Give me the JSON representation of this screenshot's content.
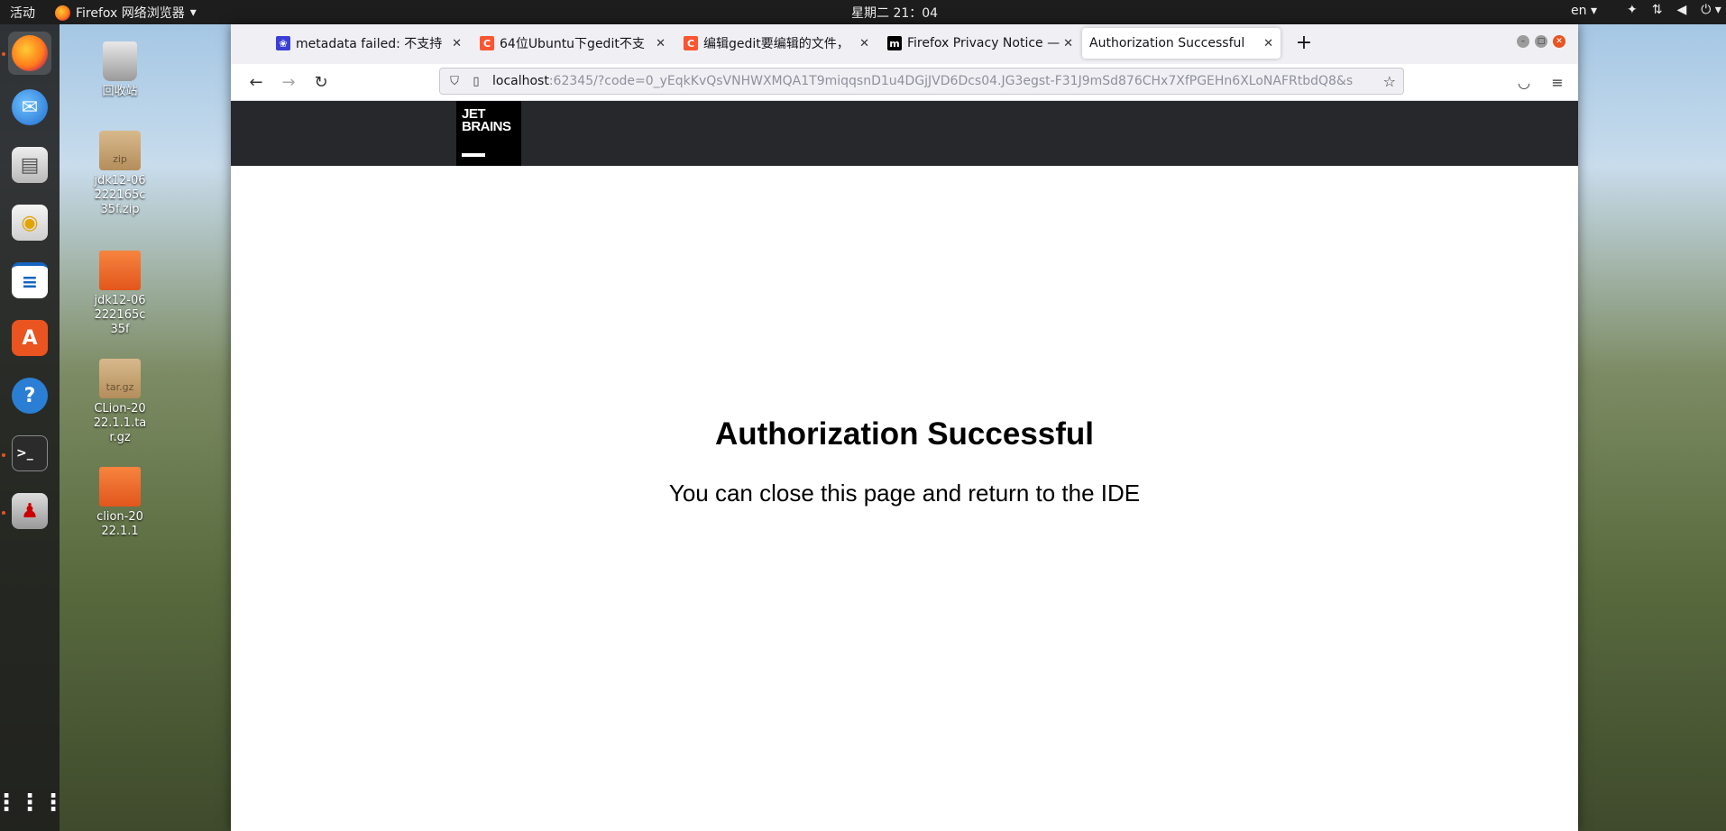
{
  "topbar": {
    "activities": "活动",
    "app_name": "Firefox 网络浏览器",
    "clock": "星期二 21：04",
    "lang": "en"
  },
  "desktop_icons": [
    {
      "label": "回收站",
      "kind": "trash"
    },
    {
      "label": "jdk12-06222165c35f.zip",
      "kind": "zip",
      "tag": "zip"
    },
    {
      "label": "jdk12-06222165c35f",
      "kind": "folder"
    },
    {
      "label": "CLion-2022.1.1.tar.gz",
      "kind": "targz",
      "tag": "tar.gz"
    },
    {
      "label": "clion-2022.1.1",
      "kind": "folder"
    }
  ],
  "tabs": [
    {
      "title": "metadata failed: 不支持",
      "icon": "baidu-icon"
    },
    {
      "title": "64位Ubuntu下gedit不支",
      "icon": "csdn-icon"
    },
    {
      "title": "编辑gedit要编辑的文件，",
      "icon": "csdn-icon"
    },
    {
      "title": "Firefox Privacy Notice —",
      "icon": "mozilla-icon"
    },
    {
      "title": "Authorization Successful",
      "icon": "none",
      "active": true
    }
  ],
  "url": {
    "host": "localhost",
    "rest": ":62345/?code=0_yEqkKvQsVNHWXMQA1T9miqqsnD1u4DGjJVD6Dcs04.JG3egst-F31J9mSd876CHx7XfPGEHn6XLoNAFRtbdQ8&s"
  },
  "page": {
    "logo_line1": "JET",
    "logo_line2": "BRAINS",
    "title": "Authorization Successful",
    "subtitle": "You can close this page and return to the IDE"
  },
  "colors": {
    "accent": "#e95420",
    "jb_header": "#27282c"
  }
}
